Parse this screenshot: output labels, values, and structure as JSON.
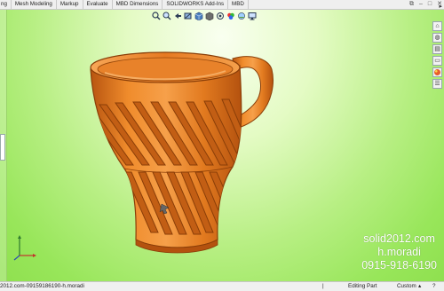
{
  "tabs": [
    "ng",
    "Mesh Modeling",
    "Markup",
    "Evaluate",
    "MBD Dimensions",
    "SOLIDWORKS Add-Ins",
    "MBD"
  ],
  "window_controls": {
    "restore": "⧉",
    "minimize": "‒",
    "maximize": "□",
    "close": "✕"
  },
  "hud_icons": [
    "magnify-icon",
    "zoom-area-icon",
    "previous-view-icon",
    "section-view-icon",
    "view-orientation-icon",
    "display-style-icon",
    "hide-show-icon",
    "appearance-icon",
    "scene-icon",
    "monitor-icon"
  ],
  "taskpane_icons": [
    "home-icon",
    "resources-icon",
    "library-icon",
    "file-explorer-icon",
    "appearances-icon",
    "custom-properties-icon"
  ],
  "watermark": {
    "line1": "solid2012.com",
    "line2": "h.moradi",
    "line3": "0915-918-6190"
  },
  "status": {
    "left_text": "2012.com-09159186190-h.moradi",
    "mode": "Editing Part",
    "units": "Custom",
    "units_caret": "▴",
    "help": "?"
  },
  "colors": {
    "viewport_bg": "#98e65a",
    "cup": "#e6781e",
    "cup_dark": "#b4520f",
    "cup_light": "#f7a452"
  }
}
